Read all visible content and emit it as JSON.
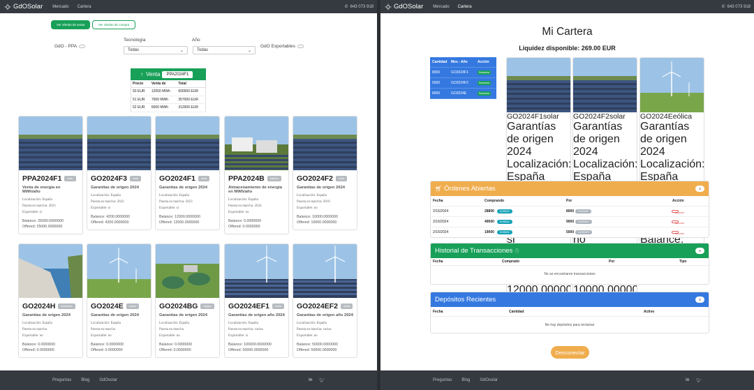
{
  "brand": "GdOSolar",
  "nav": {
    "market": "Mercado",
    "portfolio": "Cartera",
    "phone": "643 073 918"
  },
  "footer": {
    "faq": "Preguntas",
    "blog": "Blog",
    "brand": "GdOsolar"
  },
  "left": {
    "btn_sell": "Ver ofertas de venta",
    "btn_buy": "Ver ofertas de compra",
    "filter_ppa": "GdO - PPA",
    "filter_tech_label": "Tecnología",
    "filter_tech_value": "Todas",
    "filter_year_label": "Año",
    "filter_year_value": "Todas",
    "filter_export": "GdO Exportables",
    "venta": {
      "label": "Venta",
      "tag": "PPA2024F1",
      "headers": [
        "Precio",
        "Venta de",
        "Total"
      ],
      "rows": [
        [
          "50 EUR",
          "12000 MWh",
          "600000 EUR"
        ],
        [
          "51 EUR",
          "7000 MWh",
          "357000 EUR"
        ],
        [
          "52 EUR",
          "6000 MWh",
          "312000 EUR"
        ]
      ]
    },
    "cards": [
      {
        "title": "PPA2024F1",
        "badge": "solar",
        "sub": "Venta de energía en MWh/año",
        "meta": [
          "Localización: España",
          "Puesta en marcha: 2023",
          "Exportable: si"
        ],
        "balance": "Balance: 25000.0000000",
        "offered": "Offered: 25000.0000000",
        "img": "solar"
      },
      {
        "title": "GO2024F3",
        "badge": "solar",
        "sub": "Garantías de origen 2024",
        "meta": [
          "Localización: España",
          "Puesta en marcha: 2022",
          "Exportable: si"
        ],
        "balance": "Balance: 4200.0000000",
        "offered": "Offered: 4200.0000000",
        "img": "solar"
      },
      {
        "title": "GO2024F1",
        "badge": "solar",
        "sub": "Garantías de origen 2024",
        "meta": [
          "Localización: España",
          "Puesta en marcha: 2023",
          "Exportable: si"
        ],
        "balance": "Balance: 12000.0000000",
        "offered": "Offered: 12000.0000000",
        "img": "solar"
      },
      {
        "title": "PPA2024B",
        "badge": "batería",
        "sub": "Almacenamiento de energía en MWh/año",
        "meta": [
          "Localización: España",
          "Puesta en marcha: 2024",
          "Exportable: no"
        ],
        "balance": "Balance: 0.0000000",
        "offered": "Offered: 0.0000000",
        "img": "battery"
      },
      {
        "title": "GO2024F2",
        "badge": "solar",
        "sub": "Garantías de origen 2024",
        "meta": [
          "Localización: España",
          "Puesta en marcha: 2010",
          "Exportable: no"
        ],
        "balance": "Balance: 10000.0000000",
        "offered": "Offered: 10000.0000000",
        "img": "solar"
      },
      {
        "title": "GO2024H",
        "badge": "hidráulica",
        "sub": "Garantías de origen 2024",
        "meta": [
          "Localización: España",
          "Puesta en marcha",
          "Exportable: no"
        ],
        "balance": "Balance: 0.0000000",
        "offered": "Offered: 0.0000000",
        "img": "hydro"
      },
      {
        "title": "GO2024E",
        "badge": "eólica",
        "sub": "Garantías de origen 2024",
        "meta": [
          "Localización: España",
          "Puesta en marcha",
          "Exportable: no"
        ],
        "balance": "Balance: 0.0000000",
        "offered": "Offered: 0.0000000",
        "img": "wind"
      },
      {
        "title": "GO2024BG",
        "badge": "biogas",
        "sub": "Garantías de origen 2024",
        "meta": [
          "Localización: España",
          "Puesta en marcha",
          "Exportable: no"
        ],
        "balance": "Balance: 0.0000000",
        "offered": "Offered: 0.0000000",
        "img": "biogas"
      },
      {
        "title": "GO2024EF1",
        "badge": "mixta",
        "sub": "Garantías de origen año 2024",
        "meta": [
          "Localización: España",
          "Puesta en marcha: varias",
          "Exportable: si"
        ],
        "balance": "Balance: 100000.0000000",
        "offered": "Offered: 50000.0000000",
        "img": "windsolar"
      },
      {
        "title": "GO2024EF2",
        "badge": "mixta",
        "sub": "Garantías de origen año 2024",
        "meta": [
          "Localización: España",
          "Puesta en marcha: varias",
          "Exportable: no"
        ],
        "balance": "Balance: 50000.0000000",
        "offered": "Offered: 50000.0000000",
        "img": "windsolar"
      }
    ]
  },
  "right": {
    "title": "Mi Cartera",
    "liquidity": "Liquidez disponible: 269.00 EUR",
    "mini_headers": [
      "Cantidad",
      "Mes - Año",
      "Acción"
    ],
    "mini_rows": [
      [
        "8000",
        "GO2024F1",
        "Redención"
      ],
      [
        "5000",
        "GO2024F2",
        "Redención"
      ],
      [
        "8000",
        "GO2024E",
        "Redención"
      ]
    ],
    "cards": [
      {
        "title": "GO2024F1",
        "badge": "solar",
        "sub": "Garantías de origen 2024",
        "meta": [
          "Localización: España",
          "Puesta en marcha: 2023",
          "Exportable: si"
        ],
        "balance": "Balance: 12000.0000000",
        "offered": "Offered: 12000.0000000",
        "img": "solar"
      },
      {
        "title": "GO2024F2",
        "badge": "solar",
        "sub": "Garantías de origen 2024",
        "meta": [
          "Localización: España",
          "Puesta en marcha: 2010",
          "Exportable: no"
        ],
        "balance": "Balance: 10000.0000000",
        "offered": "Offered: 10000.0000000",
        "img": "solar"
      },
      {
        "title": "GO2024E",
        "badge": "eólica",
        "sub": "Garantías de origen 2024",
        "meta": [
          "Localización: España",
          "Puesta en marcha",
          "Exportable: no"
        ],
        "balance": "Balance: 0.0000000",
        "offered": "Offered: 0.0000000",
        "img": "wind"
      }
    ],
    "orders": {
      "title": "Órdenes Abiertas",
      "count": "3",
      "headers": [
        "Fecha",
        "Comprando",
        "Por",
        "Acción"
      ],
      "rows": [
        {
          "date": "2/16/2024",
          "buy": "28800",
          "buy_chip": "EURMV2",
          "for": "8000",
          "for_chip": "GO2024E",
          "action": "Cancelar"
        },
        {
          "date": "2/16/2024",
          "buy": "49500",
          "buy_chip": "EURMV2",
          "for": "9000",
          "for_chip": "GO2024F1",
          "action": "Cancelar"
        },
        {
          "date": "2/16/2024",
          "buy": "19000",
          "buy_chip": "EURMV2",
          "for": "5000",
          "for_chip": "GO2024F2",
          "action": "Cancelar"
        }
      ]
    },
    "history": {
      "title": "Historial de Transacciones",
      "count": "0",
      "headers": [
        "Fecha",
        "Comprado",
        "Por",
        "Tipo"
      ],
      "empty": "No se encontraron transacciones"
    },
    "deposits": {
      "title": "Depósitos Recientes",
      "count": "0",
      "headers": [
        "Fecha",
        "Cantidad",
        "Activo"
      ],
      "empty": "No hay depósitos para reclamar"
    },
    "disconnect": "Desconectar"
  }
}
